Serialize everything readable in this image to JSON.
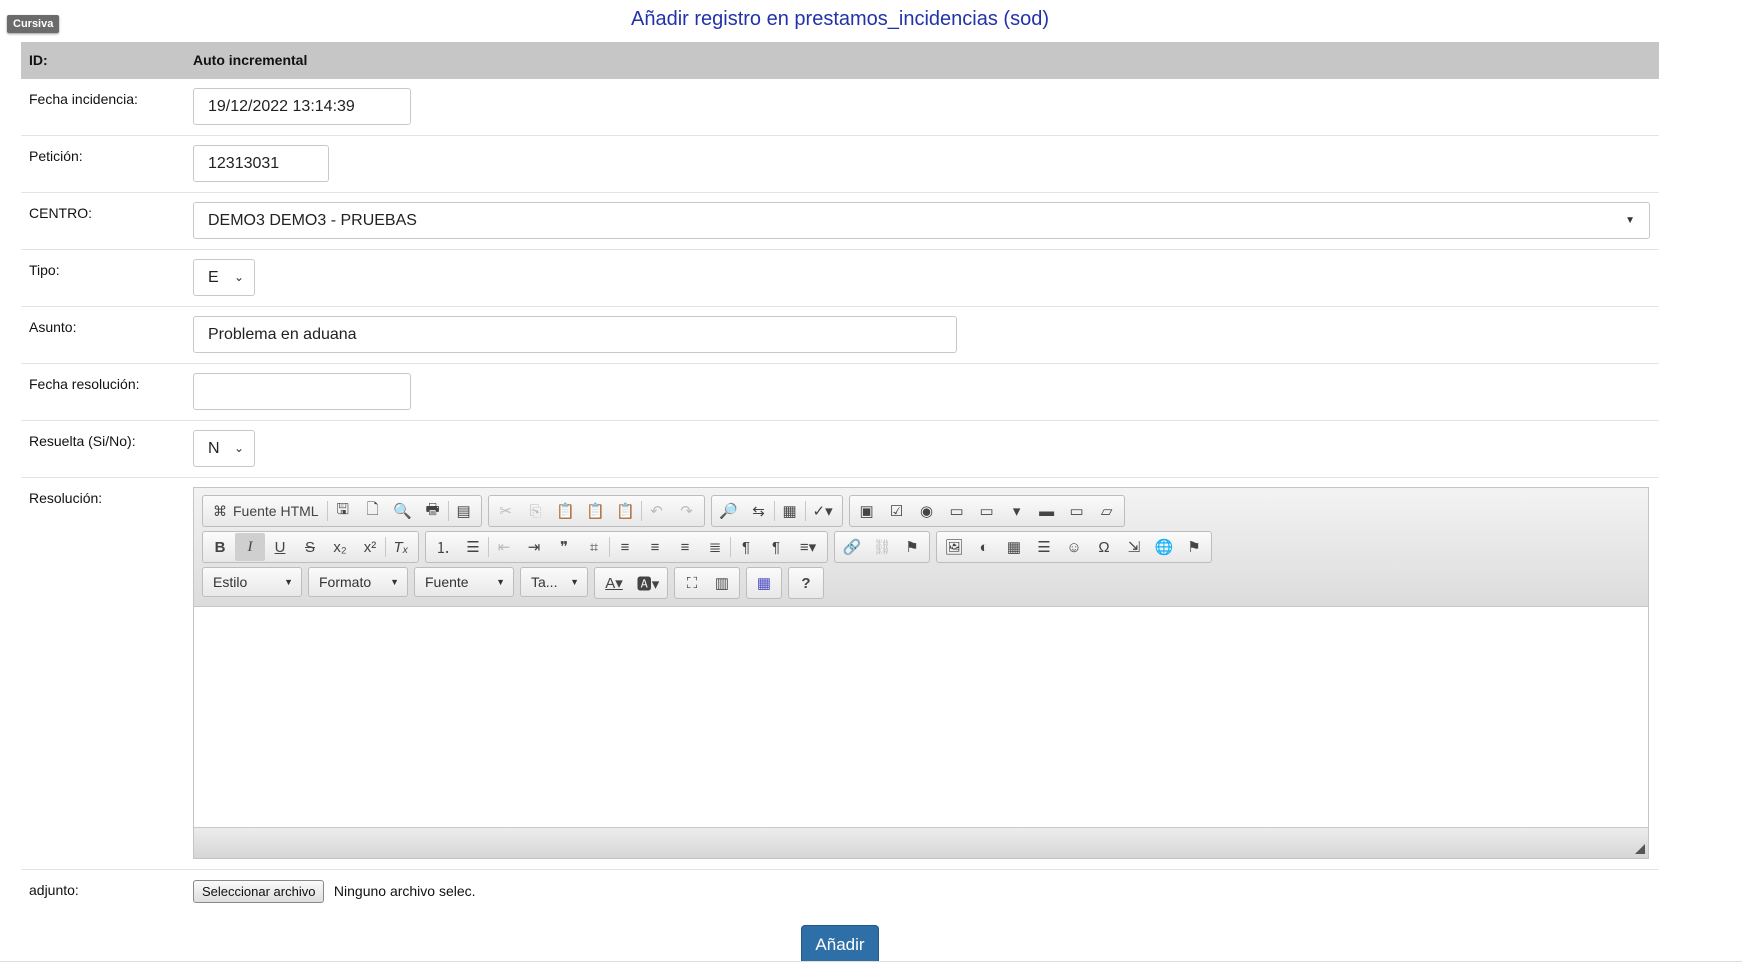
{
  "tooltip": "Cursiva",
  "title": "Añadir registro en prestamos_incidencias (sod)",
  "form": {
    "id_label": "ID:",
    "id_value": "Auto incremental",
    "fecha_incidencia_label": "Fecha incidencia:",
    "fecha_incidencia_value": "19/12/2022 13:14:39",
    "peticion_label": "Petición:",
    "peticion_value": "12313031",
    "centro_label": "CENTRO:",
    "centro_value": "DEMO3 DEMO3 - PRUEBAS",
    "tipo_label": "Tipo:",
    "tipo_value": "E",
    "asunto_label": "Asunto:",
    "asunto_value": "Problema en aduana",
    "fecha_resolucion_label": "Fecha resolución:",
    "fecha_resolucion_value": "",
    "resuelta_label": "Resuelta (Si/No):",
    "resuelta_value": "N",
    "resolucion_label": "Resolución:",
    "adjunto_label": "adjunto:",
    "file_button": "Seleccionar archivo",
    "file_status": "Ninguno archivo selec."
  },
  "editor": {
    "source_label": "Fuente HTML",
    "style_combo": "Estilo",
    "format_combo": "Formato",
    "font_combo": "Fuente",
    "size_combo": "Ta..."
  },
  "submit": "Añadir"
}
